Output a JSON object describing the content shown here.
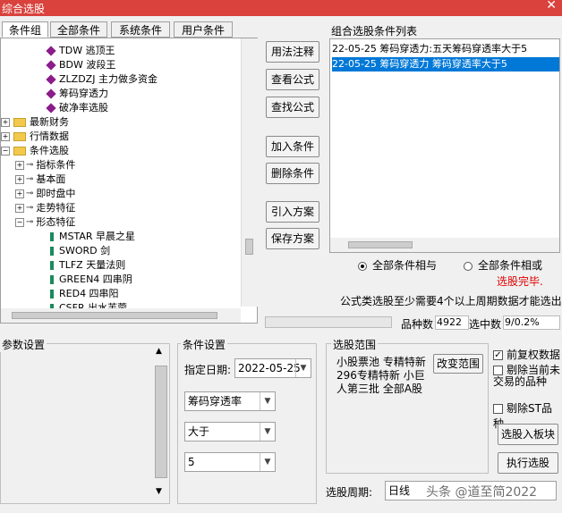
{
  "window": {
    "title": "综合选股",
    "close": "✕"
  },
  "tabs": [
    "条件组",
    "全部条件",
    "系统条件",
    "用户条件"
  ],
  "tree": [
    {
      "type": "diamond",
      "label": "TDW 逃顶王"
    },
    {
      "type": "diamond",
      "label": "BDW 波段王"
    },
    {
      "type": "diamond",
      "label": "ZLZDZJ 主力做多资金"
    },
    {
      "type": "diamond",
      "label": "筹码穿透力"
    },
    {
      "type": "diamond",
      "label": "破净率选股"
    },
    {
      "type": "folder",
      "label": "最新财务"
    },
    {
      "type": "folder",
      "label": "行情数据"
    },
    {
      "type": "folder-open",
      "label": "条件选股"
    },
    {
      "type": "key",
      "label": "指标条件"
    },
    {
      "type": "key",
      "label": "基本面"
    },
    {
      "type": "key",
      "label": "即时盘中"
    },
    {
      "type": "key",
      "label": "走势特征"
    },
    {
      "type": "key-open",
      "label": "形态特征"
    },
    {
      "type": "leaf",
      "label": "MSTAR 早晨之星"
    },
    {
      "type": "leaf",
      "label": "SWORD 剑"
    },
    {
      "type": "leaf",
      "label": "TLFZ 天量法则"
    },
    {
      "type": "leaf",
      "label": "GREEN4 四串阴"
    },
    {
      "type": "leaf",
      "label": "RED4 四串阳"
    },
    {
      "type": "leaf",
      "label": "CSFR 出水芙蓉"
    }
  ],
  "buttons": {
    "usage": "用法注释",
    "view_formula": "查看公式",
    "find_formula": "查找公式",
    "add_condition": "加入条件",
    "delete_condition": "删除条件",
    "import_plan": "引入方案",
    "save_plan": "保存方案",
    "change_range": "改变范围",
    "to_block": "选股入板块",
    "run": "执行选股"
  },
  "condition_list": {
    "title": "组合选股条件列表",
    "items": [
      "22-05-25 筹码穿透力:五天筹码穿透率大于5",
      "22-05-25 筹码穿透力 筹码穿透率大于5"
    ]
  },
  "logic": {
    "and": "全部条件相与",
    "or": "全部条件相或"
  },
  "status": {
    "done": "选股完毕.",
    "note": "公式类选股至少需要4个以上周期数据才能选出",
    "count_label": "品种数",
    "count_value": "4922",
    "selected_label": "选中数",
    "selected_value": "9/0.2%"
  },
  "params": {
    "title": "参数设置"
  },
  "cond_settings": {
    "title": "条件设置",
    "date_label": "指定日期:",
    "date_value": "2022-05-25",
    "indicator": "筹码穿透率",
    "compare": "大于",
    "value": "5"
  },
  "range": {
    "title": "选股范围",
    "text": "小股票池 专精特新 296专精特新 小巨人第三批 全部A股"
  },
  "options": {
    "restore": "前复权数据",
    "exclude_halted": "剔除当前未交易的品种",
    "exclude_st": "剔除ST品种"
  },
  "period": {
    "label": "选股周期:",
    "value": "日线"
  },
  "watermark": "头条 @道至简2022",
  "colors": {
    "title_bg": "#d9423d",
    "selected_bg": "#0078d7",
    "done_red": "#e00000"
  }
}
